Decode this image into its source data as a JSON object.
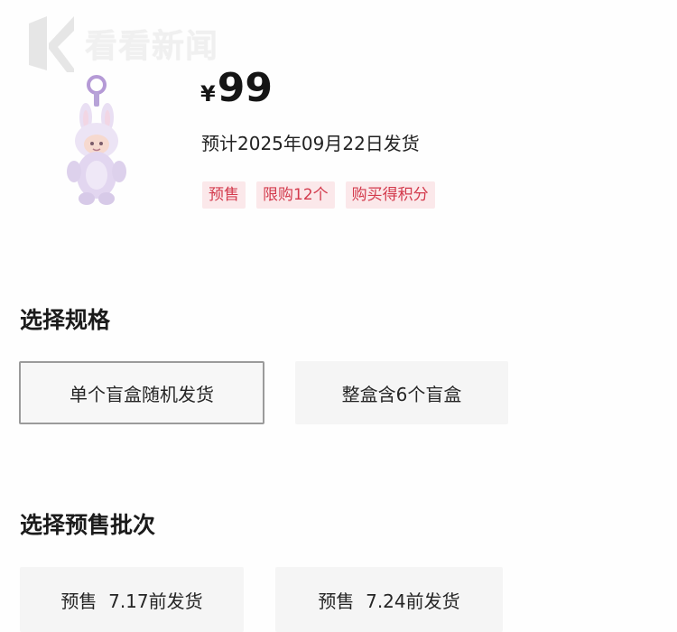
{
  "watermark": {
    "text": "看看新闻",
    "logo_icon": "k-logo-icon"
  },
  "product": {
    "image_icon": "labubu-keychain-icon",
    "currency": "¥",
    "price": "99",
    "ship_estimate": "预计2025年09月22日发货",
    "tags": [
      "预售",
      "限购12个",
      "购买得积分"
    ]
  },
  "spec": {
    "title": "选择规格",
    "options": [
      {
        "label": "单个盲盒随机发货",
        "selected": true
      },
      {
        "label": "整盒含6个盲盒",
        "selected": false
      }
    ]
  },
  "batch": {
    "title": "选择预售批次",
    "options": [
      {
        "label": "预售  7.17前发货"
      },
      {
        "label": "预售  7.24前发货"
      }
    ]
  },
  "colors": {
    "tag_bg": "#fbe8ea",
    "tag_text": "#d33a4c",
    "option_bg": "#f5f5f5",
    "selected_border": "#9b9b9b"
  }
}
